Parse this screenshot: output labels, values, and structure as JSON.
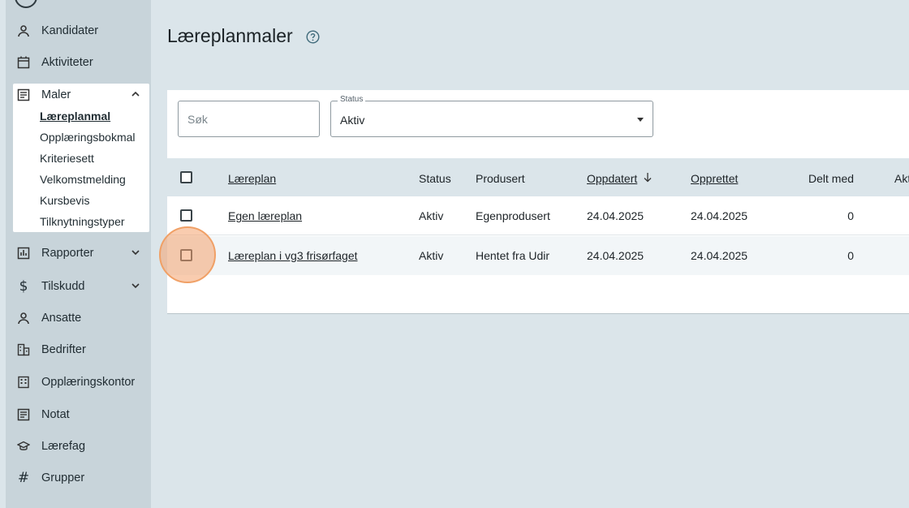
{
  "sidebar": {
    "items": [
      {
        "label": "Kandidater",
        "icon": "person-icon"
      },
      {
        "label": "Aktiviteter",
        "icon": "calendar-icon"
      },
      {
        "label": "Maler",
        "icon": "note-icon"
      },
      {
        "label": "Rapporter",
        "icon": "bar-chart-icon"
      },
      {
        "label": "Tilskudd",
        "icon": "dollar-icon"
      },
      {
        "label": "Ansatte",
        "icon": "person-icon"
      },
      {
        "label": "Bedrifter",
        "icon": "building-icon"
      },
      {
        "label": "Opplæringskontor",
        "icon": "office-icon"
      },
      {
        "label": "Notat",
        "icon": "note-icon"
      },
      {
        "label": "Lærefag",
        "icon": "school-icon"
      },
      {
        "label": "Grupper",
        "icon": "hash-icon"
      }
    ],
    "maler_sub": [
      "Læreplanmal",
      "Opplæringsbokmal",
      "Kriteriesett",
      "Velkomstmelding",
      "Kursbevis",
      "Tilknytningstyper"
    ]
  },
  "page": {
    "title": "Læreplanmaler"
  },
  "filters": {
    "search_placeholder": "Søk",
    "status_label": "Status",
    "status_value": "Aktiv"
  },
  "table": {
    "headers": {
      "laereplan": "Læreplan",
      "status": "Status",
      "produsert": "Produsert",
      "oppdatert": "Oppdatert",
      "opprettet": "Opprettet",
      "delt_med": "Delt med",
      "aktiv": "Akt"
    },
    "rows": [
      {
        "name": "Egen læreplan",
        "status": "Aktiv",
        "produsert": "Egenprodusert",
        "oppdatert": "24.04.2025",
        "opprettet": "24.04.2025",
        "delt_med": "0"
      },
      {
        "name": "Læreplan i vg3 frisørfaget",
        "status": "Aktiv",
        "produsert": "Hentet fra Udir",
        "oppdatert": "24.04.2025",
        "opprettet": "24.04.2025",
        "delt_med": "0"
      }
    ]
  },
  "colors": {
    "background": "#dbe5ea",
    "sidebar": "#c8d4da",
    "highlight": "#f4a36e"
  }
}
